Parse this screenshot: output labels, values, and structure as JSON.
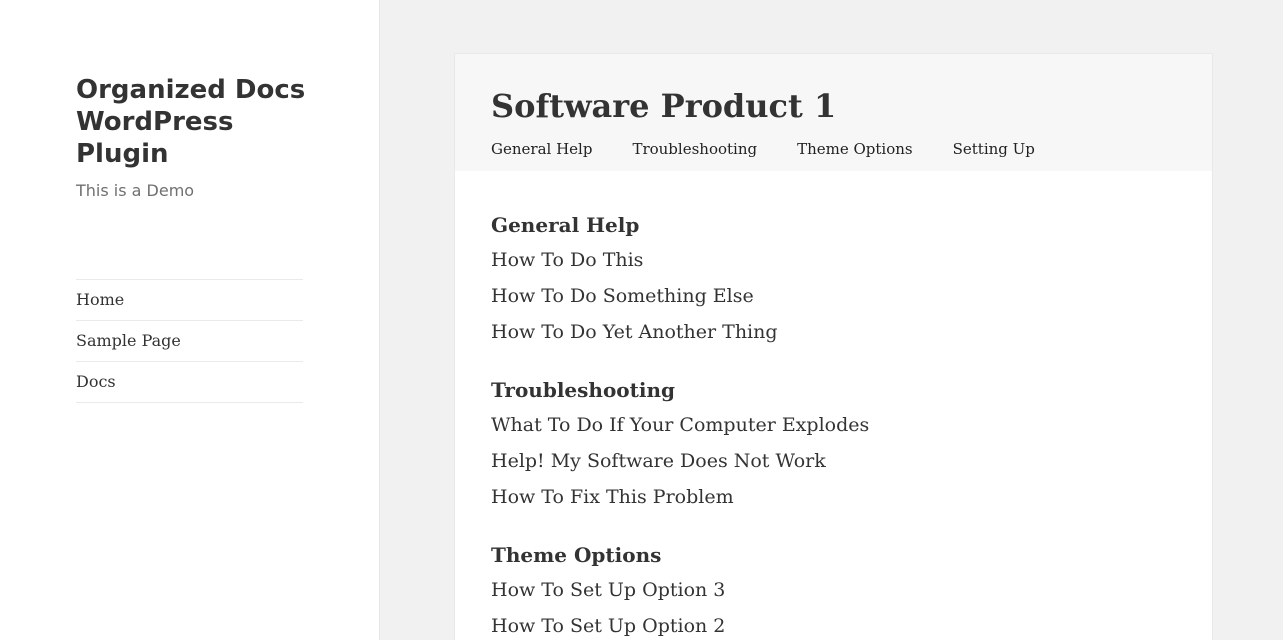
{
  "site": {
    "title": "Organized Docs WordPress Plugin",
    "tagline": "This is a Demo"
  },
  "main_nav": {
    "items": [
      {
        "label": "Home"
      },
      {
        "label": "Sample Page"
      },
      {
        "label": "Docs"
      }
    ]
  },
  "product": {
    "title": "Software Product 1",
    "tabs": [
      {
        "label": "General Help"
      },
      {
        "label": "Troubleshooting"
      },
      {
        "label": "Theme Options"
      },
      {
        "label": "Setting Up"
      }
    ]
  },
  "sections": [
    {
      "title": "General Help",
      "links": [
        {
          "label": "How To Do This"
        },
        {
          "label": "How To Do Something Else"
        },
        {
          "label": "How To Do Yet Another Thing"
        }
      ]
    },
    {
      "title": "Troubleshooting",
      "links": [
        {
          "label": "What To Do If Your Computer Explodes"
        },
        {
          "label": "Help! My Software Does Not Work"
        },
        {
          "label": "How To Fix This Problem"
        }
      ]
    },
    {
      "title": "Theme Options",
      "links": [
        {
          "label": "How To Set Up Option 3"
        },
        {
          "label": "How To Set Up Option 2"
        }
      ]
    }
  ]
}
